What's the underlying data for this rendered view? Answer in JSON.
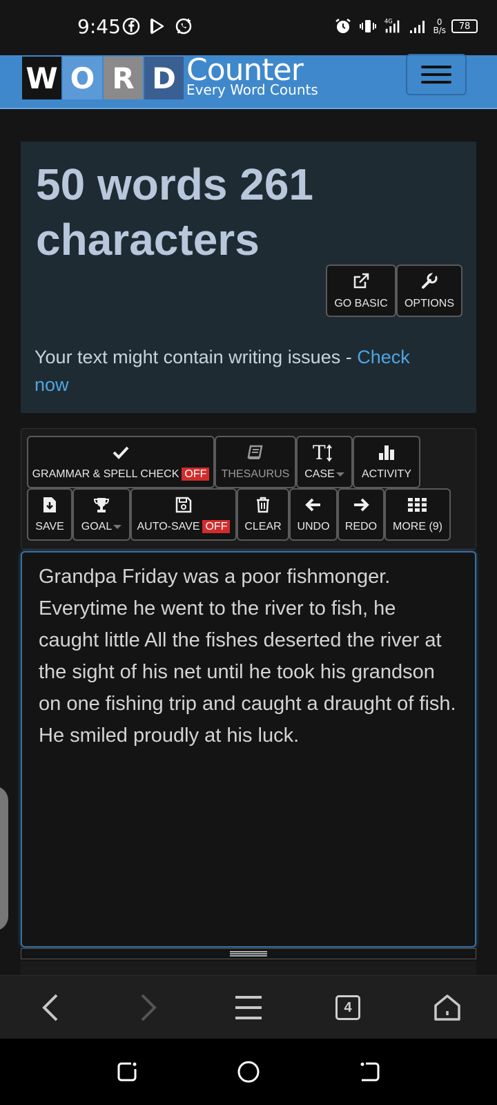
{
  "status_bar": {
    "time": "9:45",
    "network": "4G",
    "speed_value": "0",
    "speed_unit": "B/s",
    "battery": "78"
  },
  "header": {
    "logo_letters": [
      "W",
      "O",
      "R",
      "D"
    ],
    "logo_word": "Counter",
    "tagline": "Every Word Counts"
  },
  "stats": {
    "headline": "50 words 261 characters",
    "go_basic_label": "GO BASIC",
    "options_label": "OPTIONS",
    "issues_text": "Your text might contain writing issues - ",
    "issues_link": "Check now"
  },
  "toolbar": {
    "grammar_label": "GRAMMAR & SPELL CHECK",
    "grammar_state": "OFF",
    "thesaurus_label": "THESAURUS",
    "case_label": "CASE",
    "activity_label": "ACTIVITY",
    "save_label": "SAVE",
    "goal_label": "GOAL",
    "autosave_label": "AUTO-SAVE",
    "autosave_state": "OFF",
    "clear_label": "CLEAR",
    "undo_label": "UNDO",
    "redo_label": "REDO",
    "more_label": "MORE (9)"
  },
  "editor": {
    "text": "Grandpa Friday was a poor fishmonger. Everytime he went to the river to fish, he caught little All the fishes deserted the river at the sight of his net until he took his grandson on one  fishing trip and caught a draught of fish. He smiled proudly at his luck."
  },
  "browser_nav": {
    "tab_count": "4"
  },
  "colors": {
    "header_blue": "#3f88cc",
    "panel_bg": "#1f2b33",
    "headline": "#b9c7dc",
    "link": "#4ea5e3",
    "off_badge": "#d12c2c"
  }
}
